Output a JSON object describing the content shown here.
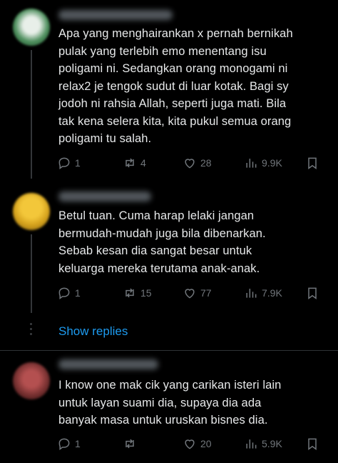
{
  "posts": [
    {
      "text": "Apa yang menghairankan x pernah bernikah\npulak yang terlebih emo menentang isu\npoligami ni. Sedangkan orang monogami ni\nrelax2 je tengok sudut di luar kotak. Bagi sy\njodoh ni rahsia Allah, seperti juga mati. Bila\ntak kena selera kita, kita pukul semua orang\npoligami tu salah.",
      "replies": "1",
      "reposts": "4",
      "likes": "28",
      "views": "9.9K",
      "avatar_color": "#4a8c5a"
    },
    {
      "text": "Betul tuan. Cuma harap lelaki jangan\nbermudah-mudah juga bila dibenarkan.\nSebab kesan dia sangat besar untuk\nkeluarga mereka terutama anak-anak.",
      "replies": "1",
      "reposts": "15",
      "likes": "77",
      "views": "7.9K",
      "avatar_color": "#d4a11c"
    },
    {
      "text": "I know one mak cik yang carikan isteri lain\nuntuk layan suami dia, supaya dia ada\nbanyak masa untuk uruskan bisnes dia.",
      "replies": "1",
      "reposts": "",
      "likes": "20",
      "views": "5.9K",
      "avatar_color": "#8a3a3a"
    }
  ],
  "show_replies_label": "Show replies",
  "colors": {
    "background": "#000000",
    "text": "#e7e9ea",
    "muted": "#71767b",
    "link": "#1d9bf0",
    "divider": "#2f3336"
  },
  "icons": [
    "reply-icon",
    "repost-icon",
    "like-icon",
    "views-icon",
    "bookmark-icon"
  ]
}
